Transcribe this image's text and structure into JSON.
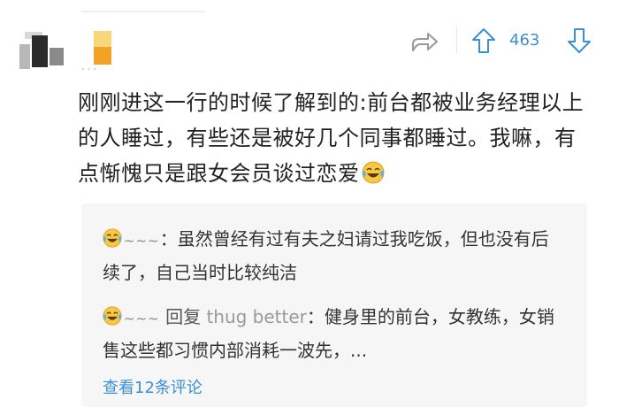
{
  "post": {
    "vote_count": "463",
    "body": "刚刚进这一行的时候了解到的:前台都被业务经理以上的人睡过，有些还是被好几个同事都睡过。我嘛，有点惭愧只是跟女会员谈过恋爱"
  },
  "replies": [
    {
      "name": "~~~",
      "separator": "：",
      "text": "虽然曾经有过有夫之妇请过我吃饭，但也没有后续了，自己当时比较纯洁"
    },
    {
      "name": "~~~",
      "reply_label": "回复",
      "target": "thug better",
      "separator": "：",
      "text": "健身里的前台，女教练，女销售这些都习惯内部消耗一波先，..."
    }
  ],
  "more_replies": "查看12条评论",
  "icons": {
    "share": "share-arrow-icon",
    "upvote": "arrow-up-icon",
    "downvote": "arrow-down-icon",
    "emoji": "laugh-cry-emoji-icon"
  },
  "colors": {
    "accent": "#3b8fd6",
    "text": "#222222",
    "muted": "#888888",
    "reply_bg": "#f6f6f6"
  }
}
